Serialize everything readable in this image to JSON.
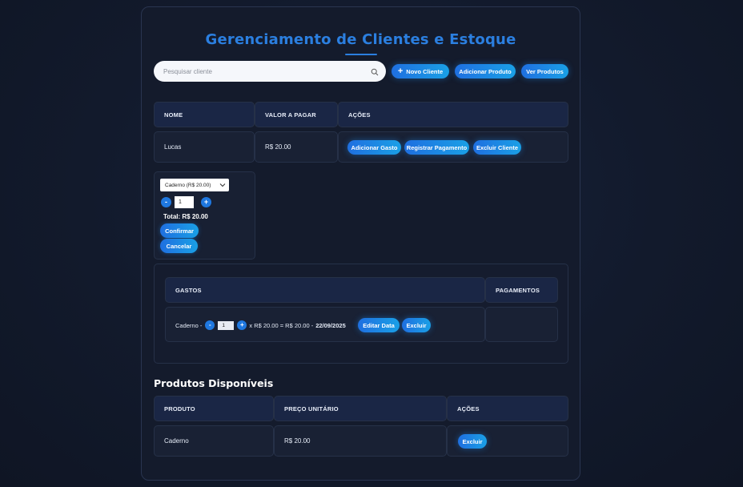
{
  "header": {
    "title": "Gerenciamento de Clientes e Estoque"
  },
  "search": {
    "placeholder": "Pesquisar cliente"
  },
  "toolbar": {
    "novo_cliente": "Novo Cliente",
    "adicionar_produto": "Adicionar Produto",
    "ver_produtos": "Ver Produtos"
  },
  "clients_table": {
    "headers": [
      "NOME",
      "VALOR A PAGAR",
      "AÇÕES"
    ],
    "rows": [
      {
        "nome": "Lucas",
        "valor": "R$ 20.00",
        "actions": [
          "Adicionar Gasto",
          "Registrar Pagamento",
          "Excluir Cliente"
        ]
      }
    ]
  },
  "add_expense": {
    "selected_product": "Caderno (R$ 20.00)",
    "minus": "-",
    "plus": "+",
    "quantity": "1",
    "total": "Total: R$ 20.00",
    "confirm": "Confirmar",
    "cancel": "Cancelar"
  },
  "history": {
    "headers": [
      "GASTOS",
      "PAGAMENTOS"
    ],
    "gasto": {
      "item": "Caderno -",
      "minus": "-",
      "qty": "1",
      "plus": "+",
      "calc": "x R$ 20.00 = R$ 20.00 -",
      "date": "22/09/2025",
      "edit_date": "Editar Data",
      "delete": "Excluir"
    }
  },
  "products": {
    "title": "Produtos Disponíveis",
    "headers": [
      "PRODUTO",
      "PREÇO UNITÁRIO",
      "AÇÕES"
    ],
    "rows": [
      {
        "produto": "Caderno",
        "preco": "R$ 20.00",
        "action": "Excluir"
      }
    ]
  },
  "colors": {
    "accent": "#1f78e0",
    "title": "#2b7fe0",
    "background": "#121a2c"
  }
}
